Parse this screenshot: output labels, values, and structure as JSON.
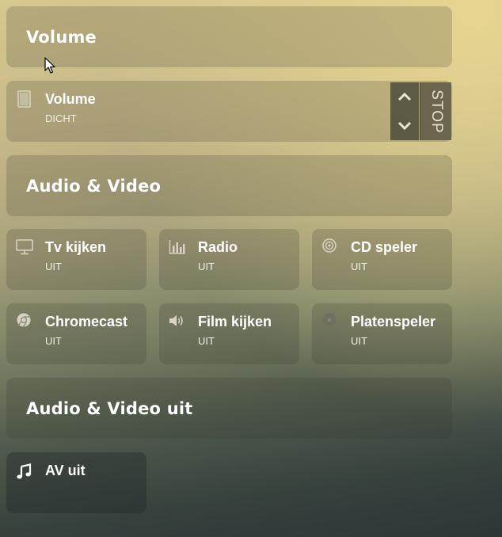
{
  "sections": {
    "volume": "Volume",
    "av": "Audio & Video",
    "av_off": "Audio & Video uit"
  },
  "volume_tile": {
    "name": "Volume",
    "status": "DICHT",
    "stop_label": "STOP",
    "icon": "blinds-icon"
  },
  "av_tiles": [
    {
      "name": "Tv kijken",
      "status": "UIT",
      "icon": "monitor-icon"
    },
    {
      "name": "Radio",
      "status": "UIT",
      "icon": "equalizer-icon"
    },
    {
      "name": "CD speler",
      "status": "UIT",
      "icon": "disc-icon"
    },
    {
      "name": "Chromecast",
      "status": "UIT",
      "icon": "chrome-icon"
    },
    {
      "name": "Film kijken",
      "status": "UIT",
      "icon": "speaker-icon"
    },
    {
      "name": "Platenspeler",
      "status": "UIT",
      "icon": "record-icon"
    }
  ],
  "av_off_tile": {
    "name": "AV uit",
    "icon": "music-note-icon"
  },
  "colors": {
    "card_bg": "rgba(55,55,45,0.20)",
    "control_bg": "#504e3e",
    "text": "#ffffff",
    "icon_muted": "#d6d3c4"
  }
}
